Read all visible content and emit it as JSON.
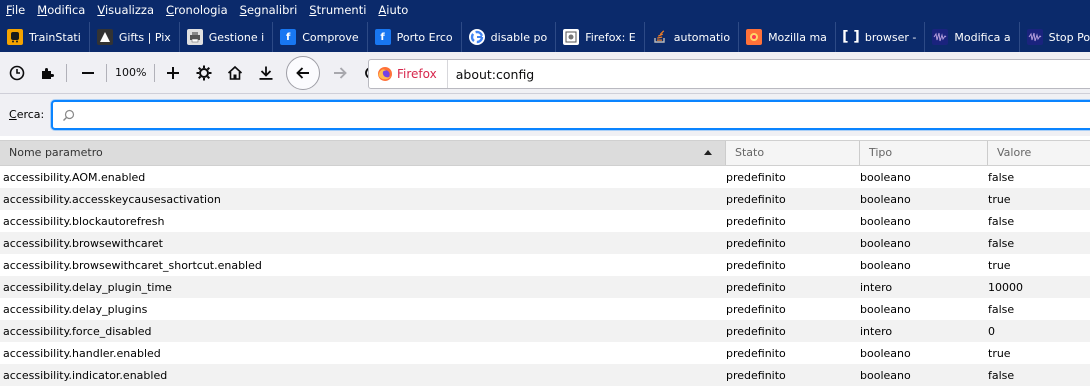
{
  "menubar": {
    "items": [
      {
        "accel": "F",
        "rest": "ile"
      },
      {
        "accel": "M",
        "rest": "odifica"
      },
      {
        "accel": "V",
        "rest": "isualizza"
      },
      {
        "accel": "C",
        "rest": "ronologia"
      },
      {
        "accel": "S",
        "rest": "egnalibri"
      },
      {
        "accel": "S",
        "rest": "trumenti"
      },
      {
        "accel": "A",
        "rest": "iuto"
      }
    ]
  },
  "bookmarks": [
    {
      "label": "TrainStati",
      "icon": "train-icon",
      "color": "#f5a300"
    },
    {
      "label": "Gifts | Pix",
      "icon": "pixel-icon",
      "color": "#333333"
    },
    {
      "label": "Gestione i",
      "icon": "printer-icon",
      "color": "#6e6e6e"
    },
    {
      "label": "Comprove",
      "icon": "facebook-icon",
      "color": "#1877f2"
    },
    {
      "label": "Porto Erco",
      "icon": "facebook-icon",
      "color": "#1877f2"
    },
    {
      "label": "disable po",
      "icon": "google-icon",
      "color": "#ffffff"
    },
    {
      "label": "Firefox: E",
      "icon": "page-icon",
      "color": "#7a7a7a"
    },
    {
      "label": "automatio",
      "icon": "stackoverflow-icon",
      "color": "#f48024"
    },
    {
      "label": "Mozilla ma",
      "icon": "mozilla-icon",
      "color": "#ff7139"
    },
    {
      "label": "browser -",
      "icon": "brackets-icon",
      "color": "#ffffff"
    },
    {
      "label": "Modifica a",
      "icon": "audio-wave-icon",
      "color": "#1a237e"
    },
    {
      "label": "Stop Popu",
      "icon": "audio-wave-icon",
      "color": "#1a237e"
    }
  ],
  "toolbar": {
    "zoom": "100%"
  },
  "urlbar": {
    "identity_label": "Firefox",
    "url": "about:config"
  },
  "search": {
    "label_accel": "C",
    "label_rest": "erca:",
    "value": ""
  },
  "table": {
    "headers": {
      "name": "Nome parametro",
      "state": "Stato",
      "type": "Tipo",
      "value": "Valore"
    },
    "rows": [
      {
        "name": "accessibility.AOM.enabled",
        "state": "predefinito",
        "type": "booleano",
        "value": "false"
      },
      {
        "name": "accessibility.accesskeycausesactivation",
        "state": "predefinito",
        "type": "booleano",
        "value": "true"
      },
      {
        "name": "accessibility.blockautorefresh",
        "state": "predefinito",
        "type": "booleano",
        "value": "false"
      },
      {
        "name": "accessibility.browsewithcaret",
        "state": "predefinito",
        "type": "booleano",
        "value": "false"
      },
      {
        "name": "accessibility.browsewithcaret_shortcut.enabled",
        "state": "predefinito",
        "type": "booleano",
        "value": "true"
      },
      {
        "name": "accessibility.delay_plugin_time",
        "state": "predefinito",
        "type": "intero",
        "value": "10000"
      },
      {
        "name": "accessibility.delay_plugins",
        "state": "predefinito",
        "type": "booleano",
        "value": "false"
      },
      {
        "name": "accessibility.force_disabled",
        "state": "predefinito",
        "type": "intero",
        "value": "0"
      },
      {
        "name": "accessibility.handler.enabled",
        "state": "predefinito",
        "type": "booleano",
        "value": "true"
      },
      {
        "name": "accessibility.indicator.enabled",
        "state": "predefinito",
        "type": "booleano",
        "value": "false"
      }
    ]
  }
}
